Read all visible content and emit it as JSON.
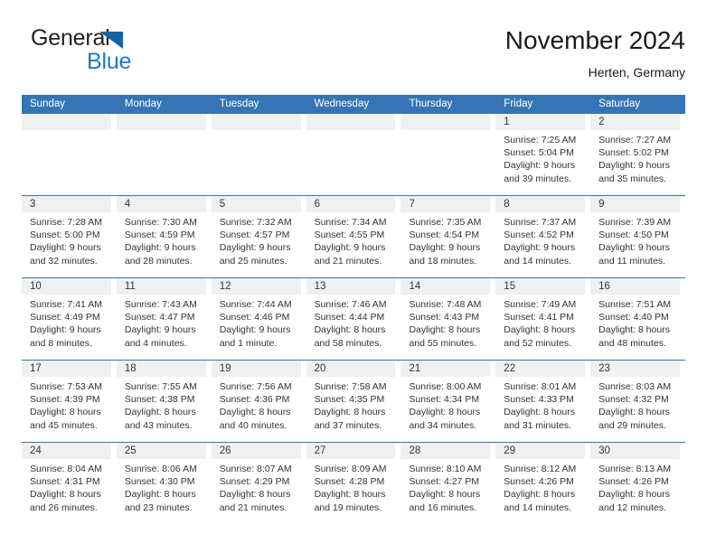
{
  "brand": {
    "name_part1": "General",
    "name_part2": "Blue",
    "triangle_color": "#1263a8",
    "blue_text_color": "#1e7ac4"
  },
  "header": {
    "title": "November 2024",
    "subtitle": "Herten, Germany"
  },
  "theme": {
    "header_blue": "#3575b5",
    "daynum_band": "#f0f0f0",
    "text": "#333333"
  },
  "weekdays": [
    "Sunday",
    "Monday",
    "Tuesday",
    "Wednesday",
    "Thursday",
    "Friday",
    "Saturday"
  ],
  "calendar": {
    "weeks": [
      [
        {
          "day": "",
          "lines": []
        },
        {
          "day": "",
          "lines": []
        },
        {
          "day": "",
          "lines": []
        },
        {
          "day": "",
          "lines": []
        },
        {
          "day": "",
          "lines": []
        },
        {
          "day": "1",
          "lines": [
            "Sunrise: 7:25 AM",
            "Sunset: 5:04 PM",
            "Daylight: 9 hours",
            "and 39 minutes."
          ]
        },
        {
          "day": "2",
          "lines": [
            "Sunrise: 7:27 AM",
            "Sunset: 5:02 PM",
            "Daylight: 9 hours",
            "and 35 minutes."
          ]
        }
      ],
      [
        {
          "day": "3",
          "lines": [
            "Sunrise: 7:28 AM",
            "Sunset: 5:00 PM",
            "Daylight: 9 hours",
            "and 32 minutes."
          ]
        },
        {
          "day": "4",
          "lines": [
            "Sunrise: 7:30 AM",
            "Sunset: 4:59 PM",
            "Daylight: 9 hours",
            "and 28 minutes."
          ]
        },
        {
          "day": "5",
          "lines": [
            "Sunrise: 7:32 AM",
            "Sunset: 4:57 PM",
            "Daylight: 9 hours",
            "and 25 minutes."
          ]
        },
        {
          "day": "6",
          "lines": [
            "Sunrise: 7:34 AM",
            "Sunset: 4:55 PM",
            "Daylight: 9 hours",
            "and 21 minutes."
          ]
        },
        {
          "day": "7",
          "lines": [
            "Sunrise: 7:35 AM",
            "Sunset: 4:54 PM",
            "Daylight: 9 hours",
            "and 18 minutes."
          ]
        },
        {
          "day": "8",
          "lines": [
            "Sunrise: 7:37 AM",
            "Sunset: 4:52 PM",
            "Daylight: 9 hours",
            "and 14 minutes."
          ]
        },
        {
          "day": "9",
          "lines": [
            "Sunrise: 7:39 AM",
            "Sunset: 4:50 PM",
            "Daylight: 9 hours",
            "and 11 minutes."
          ]
        }
      ],
      [
        {
          "day": "10",
          "lines": [
            "Sunrise: 7:41 AM",
            "Sunset: 4:49 PM",
            "Daylight: 9 hours",
            "and 8 minutes."
          ]
        },
        {
          "day": "11",
          "lines": [
            "Sunrise: 7:43 AM",
            "Sunset: 4:47 PM",
            "Daylight: 9 hours",
            "and 4 minutes."
          ]
        },
        {
          "day": "12",
          "lines": [
            "Sunrise: 7:44 AM",
            "Sunset: 4:46 PM",
            "Daylight: 9 hours",
            "and 1 minute."
          ]
        },
        {
          "day": "13",
          "lines": [
            "Sunrise: 7:46 AM",
            "Sunset: 4:44 PM",
            "Daylight: 8 hours",
            "and 58 minutes."
          ]
        },
        {
          "day": "14",
          "lines": [
            "Sunrise: 7:48 AM",
            "Sunset: 4:43 PM",
            "Daylight: 8 hours",
            "and 55 minutes."
          ]
        },
        {
          "day": "15",
          "lines": [
            "Sunrise: 7:49 AM",
            "Sunset: 4:41 PM",
            "Daylight: 8 hours",
            "and 52 minutes."
          ]
        },
        {
          "day": "16",
          "lines": [
            "Sunrise: 7:51 AM",
            "Sunset: 4:40 PM",
            "Daylight: 8 hours",
            "and 48 minutes."
          ]
        }
      ],
      [
        {
          "day": "17",
          "lines": [
            "Sunrise: 7:53 AM",
            "Sunset: 4:39 PM",
            "Daylight: 8 hours",
            "and 45 minutes."
          ]
        },
        {
          "day": "18",
          "lines": [
            "Sunrise: 7:55 AM",
            "Sunset: 4:38 PM",
            "Daylight: 8 hours",
            "and 43 minutes."
          ]
        },
        {
          "day": "19",
          "lines": [
            "Sunrise: 7:56 AM",
            "Sunset: 4:36 PM",
            "Daylight: 8 hours",
            "and 40 minutes."
          ]
        },
        {
          "day": "20",
          "lines": [
            "Sunrise: 7:58 AM",
            "Sunset: 4:35 PM",
            "Daylight: 8 hours",
            "and 37 minutes."
          ]
        },
        {
          "day": "21",
          "lines": [
            "Sunrise: 8:00 AM",
            "Sunset: 4:34 PM",
            "Daylight: 8 hours",
            "and 34 minutes."
          ]
        },
        {
          "day": "22",
          "lines": [
            "Sunrise: 8:01 AM",
            "Sunset: 4:33 PM",
            "Daylight: 8 hours",
            "and 31 minutes."
          ]
        },
        {
          "day": "23",
          "lines": [
            "Sunrise: 8:03 AM",
            "Sunset: 4:32 PM",
            "Daylight: 8 hours",
            "and 29 minutes."
          ]
        }
      ],
      [
        {
          "day": "24",
          "lines": [
            "Sunrise: 8:04 AM",
            "Sunset: 4:31 PM",
            "Daylight: 8 hours",
            "and 26 minutes."
          ]
        },
        {
          "day": "25",
          "lines": [
            "Sunrise: 8:06 AM",
            "Sunset: 4:30 PM",
            "Daylight: 8 hours",
            "and 23 minutes."
          ]
        },
        {
          "day": "26",
          "lines": [
            "Sunrise: 8:07 AM",
            "Sunset: 4:29 PM",
            "Daylight: 8 hours",
            "and 21 minutes."
          ]
        },
        {
          "day": "27",
          "lines": [
            "Sunrise: 8:09 AM",
            "Sunset: 4:28 PM",
            "Daylight: 8 hours",
            "and 19 minutes."
          ]
        },
        {
          "day": "28",
          "lines": [
            "Sunrise: 8:10 AM",
            "Sunset: 4:27 PM",
            "Daylight: 8 hours",
            "and 16 minutes."
          ]
        },
        {
          "day": "29",
          "lines": [
            "Sunrise: 8:12 AM",
            "Sunset: 4:26 PM",
            "Daylight: 8 hours",
            "and 14 minutes."
          ]
        },
        {
          "day": "30",
          "lines": [
            "Sunrise: 8:13 AM",
            "Sunset: 4:26 PM",
            "Daylight: 8 hours",
            "and 12 minutes."
          ]
        }
      ]
    ]
  }
}
